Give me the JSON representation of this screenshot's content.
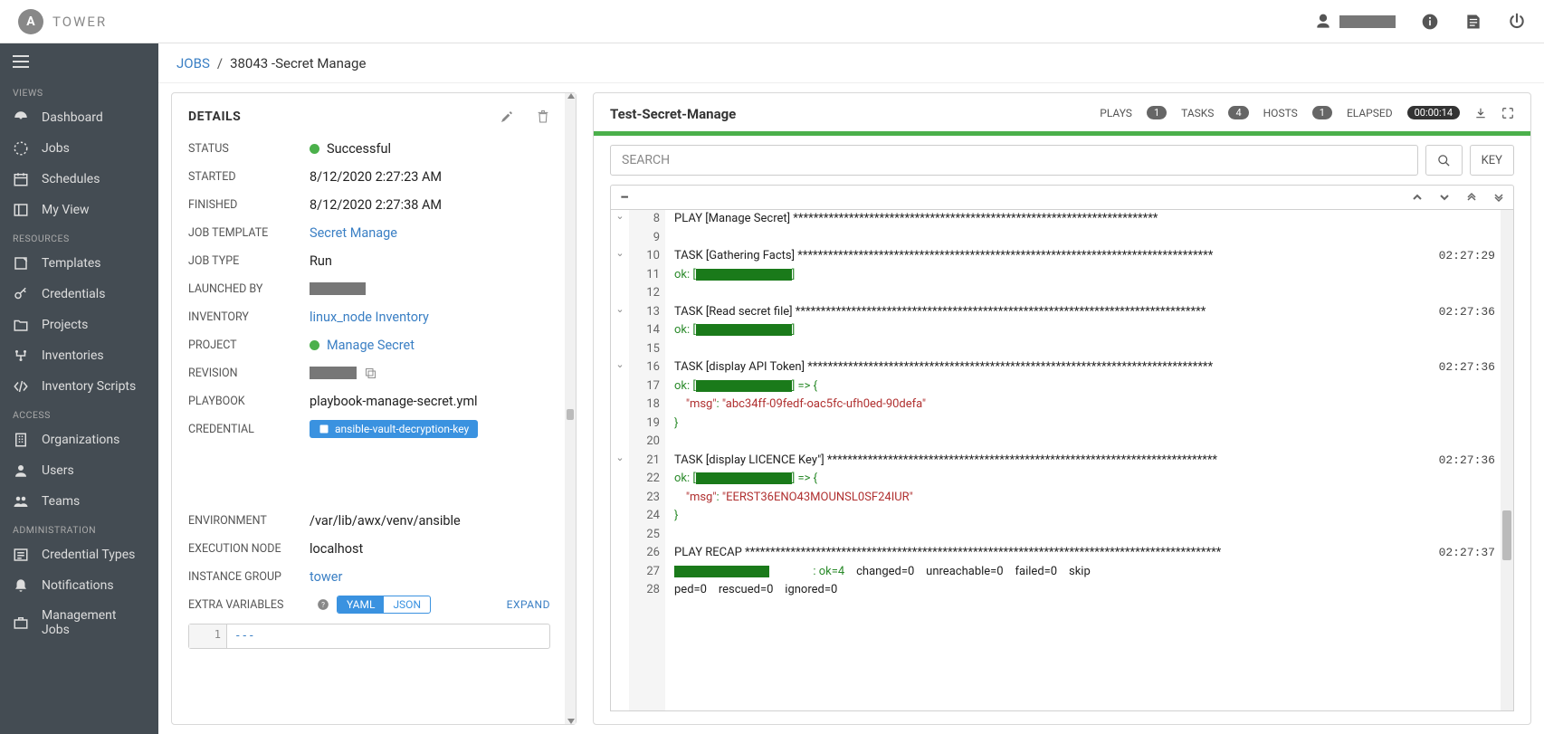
{
  "brand": "TOWER",
  "topbar": {
    "user_redacted": true
  },
  "sidebar": {
    "sections": [
      {
        "title": "VIEWS",
        "items": [
          "Dashboard",
          "Jobs",
          "Schedules",
          "My View"
        ]
      },
      {
        "title": "RESOURCES",
        "items": [
          "Templates",
          "Credentials",
          "Projects",
          "Inventories",
          "Inventory Scripts"
        ]
      },
      {
        "title": "ACCESS",
        "items": [
          "Organizations",
          "Users",
          "Teams"
        ]
      },
      {
        "title": "ADMINISTRATION",
        "items": [
          "Credential Types",
          "Notifications",
          "Management Jobs"
        ]
      }
    ]
  },
  "breadcrumb": {
    "root": "JOBS",
    "current": "38043 -Secret Manage"
  },
  "details": {
    "title": "DETAILS",
    "status_label": "STATUS",
    "status": "Successful",
    "started_label": "STARTED",
    "started": "8/12/2020 2:27:23 AM",
    "finished_label": "FINISHED",
    "finished": "8/12/2020 2:27:38 AM",
    "template_label": "JOB TEMPLATE",
    "template": "Secret Manage",
    "type_label": "JOB TYPE",
    "type": "Run",
    "launched_label": "LAUNCHED BY",
    "inventory_label": "INVENTORY",
    "inventory": "linux_node Inventory",
    "project_label": "PROJECT",
    "project": "Manage Secret",
    "revision_label": "REVISION",
    "playbook_label": "PLAYBOOK",
    "playbook": "playbook-manage-secret.yml",
    "credential_label": "CREDENTIAL",
    "credential": "ansible-vault-decryption-key",
    "env_label": "ENVIRONMENT",
    "env": "/var/lib/awx/venv/ansible",
    "exec_label": "EXECUTION NODE",
    "exec": "localhost",
    "ig_label": "INSTANCE GROUP",
    "ig": "tower",
    "extra_label": "EXTRA VARIABLES",
    "yaml": "YAML",
    "json": "JSON",
    "expand": "EXPAND",
    "code_line": "1",
    "code_text": "---"
  },
  "output": {
    "title": "Test-Secret-Manage",
    "plays_label": "PLAYS",
    "plays": "1",
    "tasks_label": "TASKS",
    "tasks": "4",
    "hosts_label": "HOSTS",
    "hosts": "1",
    "elapsed_label": "ELAPSED",
    "elapsed": "00:00:14",
    "search_placeholder": "SEARCH",
    "key": "KEY",
    "lines": [
      {
        "n": 8,
        "fold": "v",
        "text": "PLAY [Manage Secret] ************************************************************************",
        "ts": ""
      },
      {
        "n": 9,
        "text": ""
      },
      {
        "n": 10,
        "fold": "v",
        "text": "TASK [Gathering Facts] **********************************************************************************",
        "ts": "02:27:29"
      },
      {
        "n": 11,
        "ok": true,
        "redact": 106
      },
      {
        "n": 12,
        "text": ""
      },
      {
        "n": 13,
        "fold": "v",
        "text": "TASK [Read secret file] *********************************************************************************",
        "ts": "02:27:36"
      },
      {
        "n": 14,
        "ok": true,
        "redact": 106
      },
      {
        "n": 15,
        "text": ""
      },
      {
        "n": 16,
        "fold": "v",
        "text": "TASK [display API Token] ********************************************************************************",
        "ts": "02:27:36"
      },
      {
        "n": 17,
        "ok": true,
        "redact": 106,
        "arrow": true
      },
      {
        "n": 18,
        "msg": "abc34ff-09fedf-oac5fc-ufh0ed-90defa"
      },
      {
        "n": 19,
        "text": "}",
        "ok_plain": true
      },
      {
        "n": 20,
        "text": ""
      },
      {
        "n": 21,
        "fold": "v",
        "text": "TASK [display LICENCE Key\"] *****************************************************************************",
        "ts": "02:27:36"
      },
      {
        "n": 22,
        "ok": true,
        "redact": 106,
        "arrow": true
      },
      {
        "n": 23,
        "msg": "EERST36ENO43MOUNSL0SF24IUR"
      },
      {
        "n": 24,
        "text": "}",
        "ok_plain": true
      },
      {
        "n": 25,
        "text": ""
      },
      {
        "n": 26,
        "text": "PLAY RECAP **********************************************************************************************",
        "ts": "02:27:37"
      },
      {
        "n": 27,
        "recap": true
      },
      {
        "n": 28,
        "recap2": true
      }
    ],
    "recap_text": {
      "ok": "ok=4",
      "changed": "changed=0",
      "unreach": "unreachable=0",
      "failed": "failed=0",
      "skip": "skip",
      "ped": "ped=0",
      "rescued": "rescued=0",
      "ignored": "ignored=0"
    }
  }
}
